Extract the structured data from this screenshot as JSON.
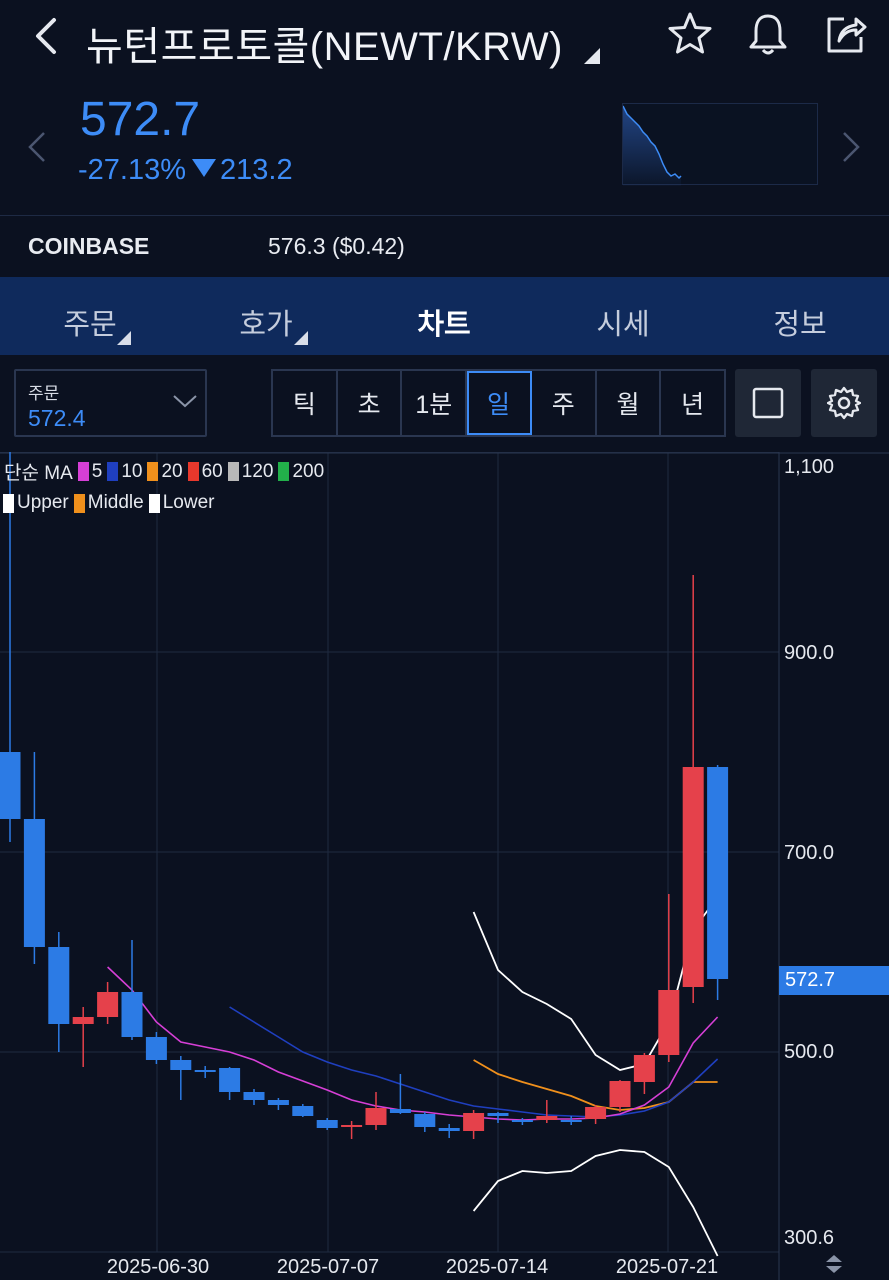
{
  "header": {
    "title": "뉴턴프로토콜(NEWT/KRW)",
    "back_icon": "chevron-left-icon",
    "actions": [
      "star-icon",
      "bell-icon",
      "share-icon"
    ]
  },
  "summary": {
    "price": "572.7",
    "change_pct": "-27.13%",
    "change_abs": "213.2",
    "color": "#3d8cf7"
  },
  "exchange": {
    "name": "COINBASE",
    "value": "576.3 ($0.42)"
  },
  "tabs": [
    {
      "label": "주문",
      "dropdown": true
    },
    {
      "label": "호가",
      "dropdown": true
    },
    {
      "label": "차트",
      "active": true
    },
    {
      "label": "시세"
    },
    {
      "label": "정보"
    }
  ],
  "order_select": {
    "label": "주문",
    "value": "572.4"
  },
  "periods": [
    "틱",
    "초",
    "1분",
    "일",
    "주",
    "월",
    "년"
  ],
  "active_period": "일",
  "legend": {
    "ma_title": "단순 MA",
    "ma": [
      {
        "label": "5",
        "color": "#d63fd6"
      },
      {
        "label": "10",
        "color": "#1f3fbf"
      },
      {
        "label": "20",
        "color": "#f0901c"
      },
      {
        "label": "60",
        "color": "#e8382c"
      },
      {
        "label": "120",
        "color": "#b8b8b8"
      },
      {
        "label": "200",
        "color": "#22b04a"
      }
    ],
    "bands": [
      {
        "label": "Upper",
        "color": "#ffffff"
      },
      {
        "label": "Middle",
        "color": "#f0901c"
      },
      {
        "label": "Lower",
        "color": "#ffffff"
      }
    ]
  },
  "chart_data": {
    "type": "candlestick",
    "y_ticks": [
      "1,100",
      "900.0",
      "700.0",
      "500.0",
      "300.6"
    ],
    "x_ticks": [
      "2025-06-30",
      "2025-07-07",
      "2025-07-14",
      "2025-07-21"
    ],
    "last_price_label": "572.7",
    "ylim": [
      300.6,
      1100
    ],
    "up_color": "#e5414b",
    "down_color": "#2c7be5",
    "candles": [
      {
        "o": 800,
        "h": 1150,
        "l": 710,
        "c": 733
      },
      {
        "o": 733,
        "h": 800,
        "l": 588,
        "c": 605
      },
      {
        "o": 605,
        "h": 620,
        "l": 500,
        "c": 528
      },
      {
        "o": 528,
        "h": 545,
        "l": 485,
        "c": 535
      },
      {
        "o": 535,
        "h": 570,
        "l": 528,
        "c": 560
      },
      {
        "o": 560,
        "h": 612,
        "l": 512,
        "c": 515
      },
      {
        "o": 515,
        "h": 520,
        "l": 488,
        "c": 492
      },
      {
        "o": 492,
        "h": 496,
        "l": 452,
        "c": 482
      },
      {
        "o": 482,
        "h": 486,
        "l": 474,
        "c": 480
      },
      {
        "o": 484,
        "h": 485,
        "l": 452,
        "c": 460
      },
      {
        "o": 460,
        "h": 463,
        "l": 447,
        "c": 452
      },
      {
        "o": 452,
        "h": 454,
        "l": 442,
        "c": 447
      },
      {
        "o": 446,
        "h": 448,
        "l": 435,
        "c": 436
      },
      {
        "o": 432,
        "h": 434,
        "l": 422,
        "c": 424
      },
      {
        "o": 425,
        "h": 431,
        "l": 413,
        "c": 427
      },
      {
        "o": 427,
        "h": 460,
        "l": 422,
        "c": 444
      },
      {
        "o": 443,
        "h": 478,
        "l": 438,
        "c": 439
      },
      {
        "o": 438,
        "h": 440,
        "l": 420,
        "c": 425
      },
      {
        "o": 424,
        "h": 428,
        "l": 414,
        "c": 421
      },
      {
        "o": 421,
        "h": 442,
        "l": 413,
        "c": 439
      },
      {
        "o": 439,
        "h": 440,
        "l": 429,
        "c": 436
      },
      {
        "o": 432,
        "h": 434,
        "l": 427,
        "c": 430
      },
      {
        "o": 432,
        "h": 452,
        "l": 429,
        "c": 436
      },
      {
        "o": 432,
        "h": 436,
        "l": 427,
        "c": 431
      },
      {
        "o": 433,
        "h": 447,
        "l": 428,
        "c": 445
      },
      {
        "o": 445,
        "h": 472,
        "l": 440,
        "c": 471
      },
      {
        "o": 470,
        "h": 499,
        "l": 458,
        "c": 497
      },
      {
        "o": 497,
        "h": 658,
        "l": 490,
        "c": 562
      },
      {
        "o": 565,
        "h": 977,
        "l": 549,
        "c": 785
      },
      {
        "o": 785,
        "h": 787,
        "l": 552,
        "c": 573
      }
    ],
    "ma5": [
      null,
      null,
      null,
      null,
      585,
      562,
      530,
      510,
      505,
      500,
      492,
      480,
      471,
      462,
      452,
      446,
      442,
      440,
      437,
      435,
      433,
      432,
      433,
      433,
      434,
      438,
      447,
      465,
      509,
      535
    ],
    "ma10": [
      null,
      null,
      null,
      null,
      null,
      null,
      null,
      null,
      null,
      545,
      530,
      515,
      500,
      490,
      482,
      476,
      468,
      460,
      452,
      446,
      443,
      440,
      437,
      436,
      435,
      437,
      441,
      450,
      470,
      493
    ],
    "bb_upper": [
      null,
      null,
      null,
      null,
      null,
      null,
      null,
      null,
      null,
      null,
      null,
      null,
      null,
      null,
      null,
      null,
      null,
      null,
      null,
      640,
      582,
      560,
      548,
      533,
      497,
      482,
      488,
      530,
      622,
      655
    ],
    "bb_middle": [
      null,
      null,
      null,
      null,
      null,
      null,
      null,
      null,
      null,
      null,
      null,
      null,
      null,
      null,
      null,
      null,
      null,
      null,
      null,
      492,
      478,
      470,
      463,
      456,
      446,
      442,
      444,
      450,
      470,
      470
    ],
    "bb_lower": [
      null,
      null,
      null,
      null,
      null,
      null,
      null,
      null,
      null,
      null,
      null,
      null,
      null,
      null,
      null,
      null,
      null,
      null,
      null,
      341,
      371,
      381,
      379,
      381,
      396,
      402,
      400,
      385,
      345,
      296
    ]
  }
}
